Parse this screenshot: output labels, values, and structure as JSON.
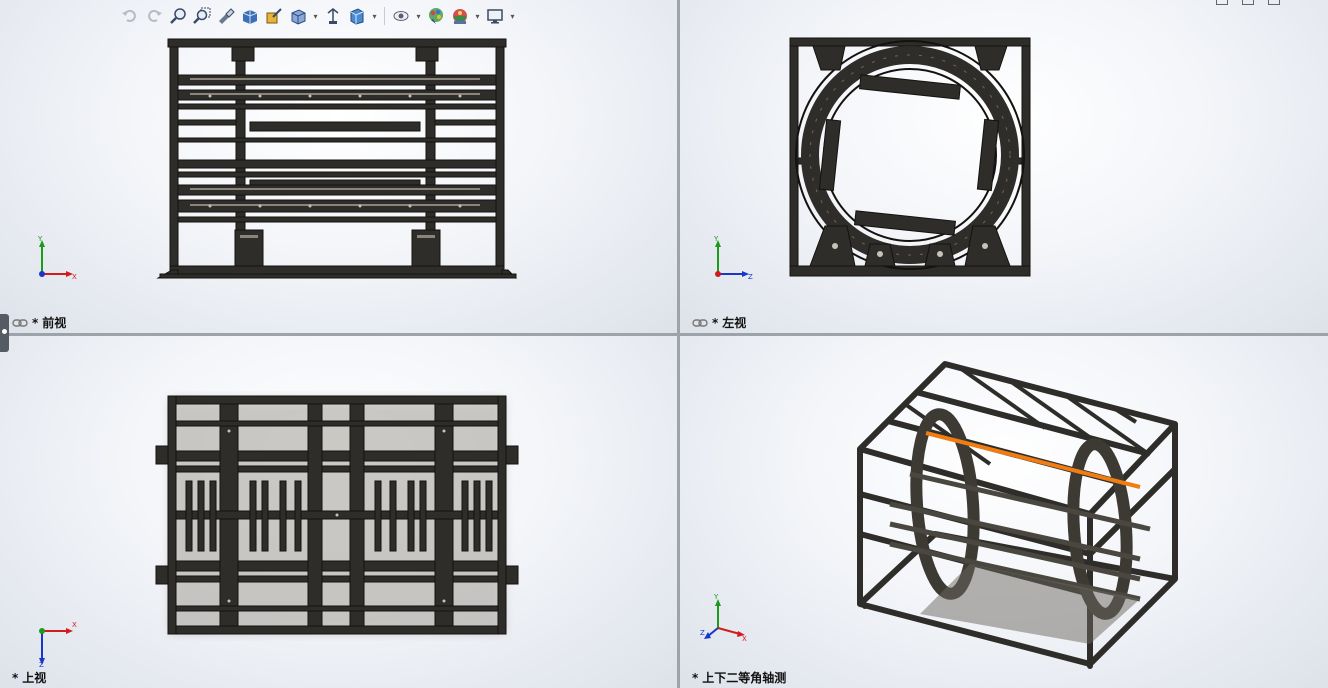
{
  "toolbar": {
    "icons": [
      "undo-view-icon",
      "redo-view-icon",
      "zoom-to-fit-icon",
      "zoom-to-area-icon",
      "previous-view-icon",
      "section-view-icon",
      "dynamic-annotation-icon",
      "view-orientation-icon",
      "display-style-icon",
      "hide-show-items-icon",
      "edit-appearance-icon",
      "apply-scene-icon",
      "view-settings-icon"
    ]
  },
  "viewports": {
    "front": {
      "label": "前视",
      "prefix": "*"
    },
    "left": {
      "label": "左视",
      "prefix": "*"
    },
    "top": {
      "label": "上视",
      "prefix": "*"
    },
    "iso": {
      "label": "上下二等角轴测",
      "prefix": "*"
    }
  },
  "axes": {
    "x": "X",
    "y": "Y",
    "z": "Z"
  },
  "colors": {
    "frame": "#2f2d29",
    "frame_light": "#6b6760",
    "highlight": "#f07d12",
    "axis_x": "#d21b1b",
    "axis_y": "#1c9a1c",
    "axis_z": "#1a36c8"
  }
}
